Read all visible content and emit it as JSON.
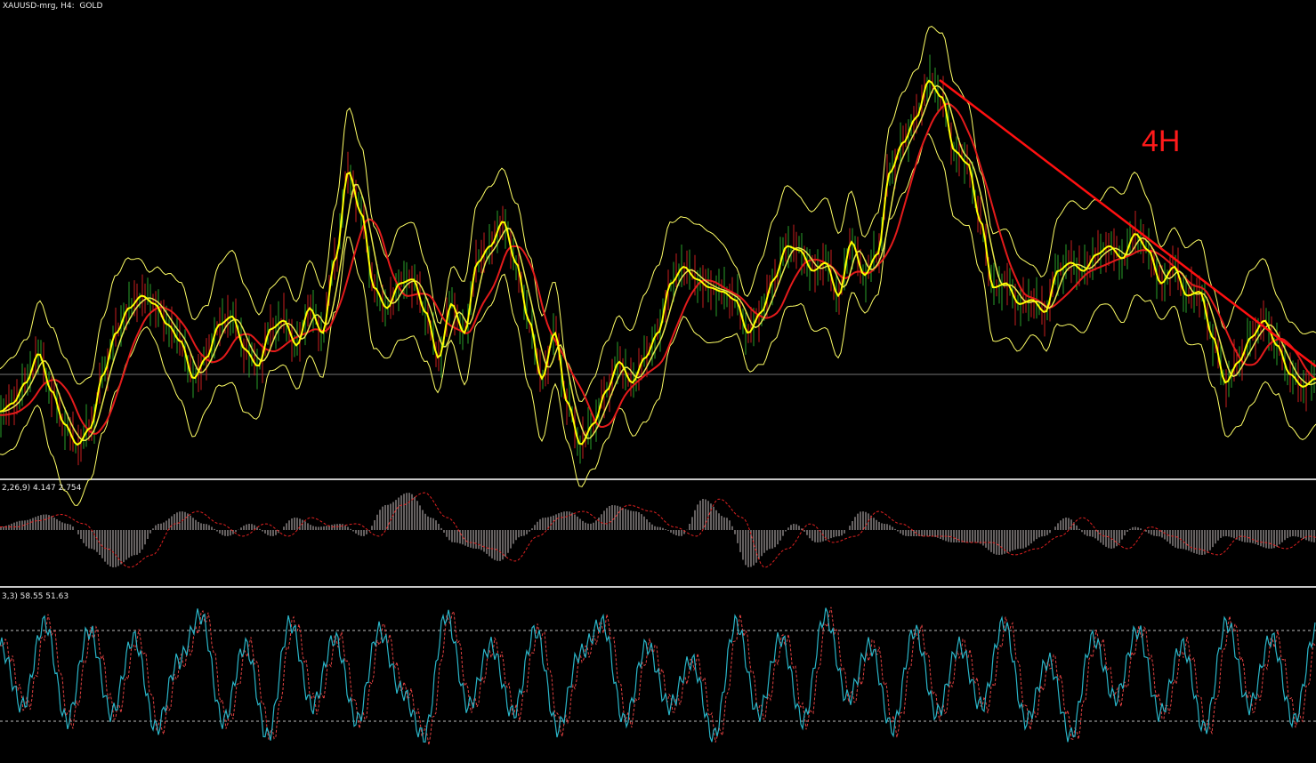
{
  "header": {
    "symbol_label": "XAUUSD-mrg, H4:  GOLD"
  },
  "annotation": {
    "timeframe_label": "4H"
  },
  "panels": {
    "macd_label": "2,26,9) 4.147 2.754",
    "stoch_label": "3,3) 58.55 51.63"
  },
  "colors": {
    "background": "#000000",
    "price_line": "#ffff00",
    "bollinger": "#ffff66",
    "ma_slow": "#e41b1b",
    "trendline": "#ff1010",
    "candle_up": "#2aa02a",
    "candle_down": "#c81e1e",
    "macd_hist": "#c8c0c0",
    "macd_signal": "#e02020",
    "stoch_main": "#2ab5c8",
    "stoch_signal": "#e04040"
  },
  "chart_data": [
    {
      "type": "line",
      "series": [
        {
          "values": [
            8,
            10,
            15,
            22,
            13,
            5,
            0,
            4,
            17,
            27,
            33,
            36,
            34,
            29,
            25,
            16,
            21,
            29,
            31,
            23,
            19,
            28,
            30,
            24,
            33,
            27,
            45,
            66,
            56,
            38,
            33,
            39,
            40,
            32,
            21,
            34,
            27,
            44,
            48,
            54,
            44,
            30,
            16,
            27,
            10,
            0,
            5,
            13,
            20,
            15,
            21,
            27,
            39,
            43,
            40,
            38,
            37,
            35,
            27,
            32,
            40,
            48,
            47,
            42,
            44,
            36,
            49,
            41,
            46,
            66,
            73,
            79,
            88,
            84,
            71,
            68,
            54,
            38,
            39,
            34,
            35,
            32,
            42,
            44,
            42,
            46,
            48,
            45,
            51,
            47,
            39,
            43,
            36,
            37,
            26,
            15,
            20,
            26,
            30,
            24,
            17,
            14,
            16
          ]
        }
      ]
    },
    {
      "type": "bar",
      "series": [
        {
          "values": [
            0.5,
            1.5,
            2.5,
            1,
            -3,
            -6,
            -4,
            1,
            3,
            1,
            -1,
            1,
            -1,
            2,
            0.5,
            1,
            -1,
            4,
            6,
            2,
            -2,
            -3,
            -5,
            -1,
            2,
            3,
            1,
            4,
            3,
            0.5,
            -1,
            5,
            2,
            -6,
            -3,
            1,
            -2,
            -1,
            3,
            1,
            -1,
            -1,
            -2,
            -2,
            -4,
            -3,
            -1,
            2,
            -1,
            -3,
            0.5,
            -1,
            -3,
            -4,
            -1,
            -2,
            -3,
            -1,
            -2
          ]
        }
      ]
    },
    {
      "type": "line",
      "ylim": [
        0,
        100
      ],
      "series": [
        {
          "values": [
            70,
            30,
            85,
            20,
            80,
            25,
            75,
            15,
            60,
            90,
            20,
            70,
            10,
            85,
            30,
            75,
            20,
            80,
            40,
            10,
            90,
            30,
            70,
            25,
            80,
            15,
            65,
            85,
            20,
            70,
            30,
            60,
            10,
            85,
            25,
            75,
            20,
            90,
            35,
            70,
            15,
            80,
            25,
            70,
            30,
            85,
            20,
            60,
            10,
            75,
            35,
            80,
            25,
            70,
            15,
            85,
            30,
            75,
            20,
            80
          ]
        }
      ]
    }
  ]
}
